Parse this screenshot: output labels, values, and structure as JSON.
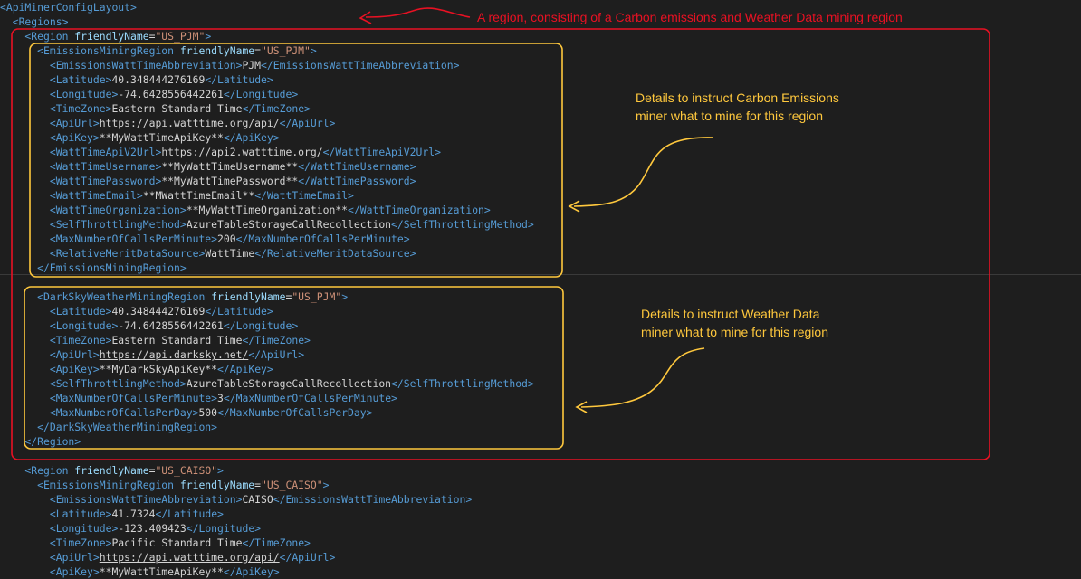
{
  "editor": {
    "lines": [
      [
        {
          "c": "tag",
          "t": "<ApiMinerConfigLayout>"
        }
      ],
      [
        {
          "c": "tag",
          "t": "  <Regions>"
        }
      ],
      [
        {
          "c": "tag",
          "t": "    <Region "
        },
        {
          "c": "attr",
          "t": "friendlyName"
        },
        {
          "c": "txt",
          "t": "="
        },
        {
          "c": "val",
          "t": "\"US_PJM\""
        },
        {
          "c": "tag",
          "t": ">"
        }
      ],
      [
        {
          "c": "tag",
          "t": "      <EmissionsMiningRegion "
        },
        {
          "c": "attr",
          "t": "friendlyName"
        },
        {
          "c": "txt",
          "t": "="
        },
        {
          "c": "val",
          "t": "\"US_PJM\""
        },
        {
          "c": "tag",
          "t": ">"
        }
      ],
      [
        {
          "c": "tag",
          "t": "        <EmissionsWattTimeAbbreviation>"
        },
        {
          "c": "txt",
          "t": "PJM"
        },
        {
          "c": "tag",
          "t": "</EmissionsWattTimeAbbreviation>"
        }
      ],
      [
        {
          "c": "tag",
          "t": "        <Latitude>"
        },
        {
          "c": "txt",
          "t": "40.348444276169"
        },
        {
          "c": "tag",
          "t": "</Latitude>"
        }
      ],
      [
        {
          "c": "tag",
          "t": "        <Longitude>"
        },
        {
          "c": "txt",
          "t": "-74.6428556442261"
        },
        {
          "c": "tag",
          "t": "</Longitude>"
        }
      ],
      [
        {
          "c": "tag",
          "t": "        <TimeZone>"
        },
        {
          "c": "txt",
          "t": "Eastern Standard Time"
        },
        {
          "c": "tag",
          "t": "</TimeZone>"
        }
      ],
      [
        {
          "c": "tag",
          "t": "        <ApiUrl>"
        },
        {
          "c": "url",
          "t": "https://api.watttime.org/api/"
        },
        {
          "c": "tag",
          "t": "</ApiUrl>"
        }
      ],
      [
        {
          "c": "tag",
          "t": "        <ApiKey>"
        },
        {
          "c": "txt",
          "t": "**MyWattTimeApiKey**"
        },
        {
          "c": "tag",
          "t": "</ApiKey>"
        }
      ],
      [
        {
          "c": "tag",
          "t": "        <WattTimeApiV2Url>"
        },
        {
          "c": "url",
          "t": "https://api2.watttime.org/"
        },
        {
          "c": "tag",
          "t": "</WattTimeApiV2Url>"
        }
      ],
      [
        {
          "c": "tag",
          "t": "        <WattTimeUsername>"
        },
        {
          "c": "txt",
          "t": "**MyWattTimeUsername**"
        },
        {
          "c": "tag",
          "t": "</WattTimeUsername>"
        }
      ],
      [
        {
          "c": "tag",
          "t": "        <WattTimePassword>"
        },
        {
          "c": "txt",
          "t": "**MyWattTimePassword**"
        },
        {
          "c": "tag",
          "t": "</WattTimePassword>"
        }
      ],
      [
        {
          "c": "tag",
          "t": "        <WattTimeEmail>"
        },
        {
          "c": "txt",
          "t": "**MWattTimeEmail**"
        },
        {
          "c": "tag",
          "t": "</WattTimeEmail>"
        }
      ],
      [
        {
          "c": "tag",
          "t": "        <WattTimeOrganization>"
        },
        {
          "c": "txt",
          "t": "**MyWattTimeOrganization**"
        },
        {
          "c": "tag",
          "t": "</WattTimeOrganization>"
        }
      ],
      [
        {
          "c": "tag",
          "t": "        <SelfThrottlingMethod>"
        },
        {
          "c": "txt",
          "t": "AzureTableStorageCallRecollection"
        },
        {
          "c": "tag",
          "t": "</SelfThrottlingMethod>"
        }
      ],
      [
        {
          "c": "tag",
          "t": "        <MaxNumberOfCallsPerMinute>"
        },
        {
          "c": "txt",
          "t": "200"
        },
        {
          "c": "tag",
          "t": "</MaxNumberOfCallsPerMinute>"
        }
      ],
      [
        {
          "c": "tag",
          "t": "        <RelativeMeritDataSource>"
        },
        {
          "c": "txt",
          "t": "WattTime"
        },
        {
          "c": "tag",
          "t": "</RelativeMeritDataSource>"
        }
      ],
      [
        {
          "c": "tag",
          "t": "      </EmissionsMiningRegion>"
        },
        {
          "c": "caret",
          "t": ""
        }
      ],
      [],
      [
        {
          "c": "tag",
          "t": "      <DarkSkyWeatherMiningRegion "
        },
        {
          "c": "attr",
          "t": "friendlyName"
        },
        {
          "c": "txt",
          "t": "="
        },
        {
          "c": "val",
          "t": "\"US_PJM\""
        },
        {
          "c": "tag",
          "t": ">"
        }
      ],
      [
        {
          "c": "tag",
          "t": "        <Latitude>"
        },
        {
          "c": "txt",
          "t": "40.348444276169"
        },
        {
          "c": "tag",
          "t": "</Latitude>"
        }
      ],
      [
        {
          "c": "tag",
          "t": "        <Longitude>"
        },
        {
          "c": "txt",
          "t": "-74.6428556442261"
        },
        {
          "c": "tag",
          "t": "</Longitude>"
        }
      ],
      [
        {
          "c": "tag",
          "t": "        <TimeZone>"
        },
        {
          "c": "txt",
          "t": "Eastern Standard Time"
        },
        {
          "c": "tag",
          "t": "</TimeZone>"
        }
      ],
      [
        {
          "c": "tag",
          "t": "        <ApiUrl>"
        },
        {
          "c": "url",
          "t": "https://api.darksky.net/"
        },
        {
          "c": "tag",
          "t": "</ApiUrl>"
        }
      ],
      [
        {
          "c": "tag",
          "t": "        <ApiKey>"
        },
        {
          "c": "txt",
          "t": "**MyDarkSkyApiKey**"
        },
        {
          "c": "tag",
          "t": "</ApiKey>"
        }
      ],
      [
        {
          "c": "tag",
          "t": "        <SelfThrottlingMethod>"
        },
        {
          "c": "txt",
          "t": "AzureTableStorageCallRecollection"
        },
        {
          "c": "tag",
          "t": "</SelfThrottlingMethod>"
        }
      ],
      [
        {
          "c": "tag",
          "t": "        <MaxNumberOfCallsPerMinute>"
        },
        {
          "c": "txt",
          "t": "3"
        },
        {
          "c": "tag",
          "t": "</MaxNumberOfCallsPerMinute>"
        }
      ],
      [
        {
          "c": "tag",
          "t": "        <MaxNumberOfCallsPerDay>"
        },
        {
          "c": "txt",
          "t": "500"
        },
        {
          "c": "tag",
          "t": "</MaxNumberOfCallsPerDay>"
        }
      ],
      [
        {
          "c": "tag",
          "t": "      </DarkSkyWeatherMiningRegion>"
        }
      ],
      [
        {
          "c": "tag",
          "t": "    </Region>"
        }
      ],
      [],
      [
        {
          "c": "tag",
          "t": "    <Region "
        },
        {
          "c": "attr",
          "t": "friendlyName"
        },
        {
          "c": "txt",
          "t": "="
        },
        {
          "c": "val",
          "t": "\"US_CAISO\""
        },
        {
          "c": "tag",
          "t": ">"
        }
      ],
      [
        {
          "c": "tag",
          "t": "      <EmissionsMiningRegion "
        },
        {
          "c": "attr",
          "t": "friendlyName"
        },
        {
          "c": "txt",
          "t": "="
        },
        {
          "c": "val",
          "t": "\"US_CAISO\""
        },
        {
          "c": "tag",
          "t": ">"
        }
      ],
      [
        {
          "c": "tag",
          "t": "        <EmissionsWattTimeAbbreviation>"
        },
        {
          "c": "txt",
          "t": "CAISO"
        },
        {
          "c": "tag",
          "t": "</EmissionsWattTimeAbbreviation>"
        }
      ],
      [
        {
          "c": "tag",
          "t": "        <Latitude>"
        },
        {
          "c": "txt",
          "t": "41.7324"
        },
        {
          "c": "tag",
          "t": "</Latitude>"
        }
      ],
      [
        {
          "c": "tag",
          "t": "        <Longitude>"
        },
        {
          "c": "txt",
          "t": "-123.409423"
        },
        {
          "c": "tag",
          "t": "</Longitude>"
        }
      ],
      [
        {
          "c": "tag",
          "t": "        <TimeZone>"
        },
        {
          "c": "txt",
          "t": "Pacific Standard Time"
        },
        {
          "c": "tag",
          "t": "</TimeZone>"
        }
      ],
      [
        {
          "c": "tag",
          "t": "        <ApiUrl>"
        },
        {
          "c": "url",
          "t": "https://api.watttime.org/api/"
        },
        {
          "c": "tag",
          "t": "</ApiUrl>"
        }
      ],
      [
        {
          "c": "tag",
          "t": "        <ApiKey>"
        },
        {
          "c": "txt",
          "t": "**MyWattTimeApiKey**"
        },
        {
          "c": "tag",
          "t": "</ApiKey>"
        }
      ]
    ]
  },
  "annotations": {
    "region_note": "A region, consisting of a Carbon emissions and Weather Data mining region",
    "emissions_note_line1": "Details to instruct Carbon Emissions",
    "emissions_note_line2": "miner what to mine for this region",
    "weather_note_line1": "Details to instruct Weather Data",
    "weather_note_line2": "miner what to mine for this region"
  },
  "colors": {
    "background": "#1e1e1e",
    "tag": "#569cd6",
    "attribute": "#9cdcfe",
    "attribute_value": "#ce9178",
    "text": "#d4d4d4",
    "annotation_red": "#e81123",
    "annotation_yellow": "#ffc83d"
  }
}
